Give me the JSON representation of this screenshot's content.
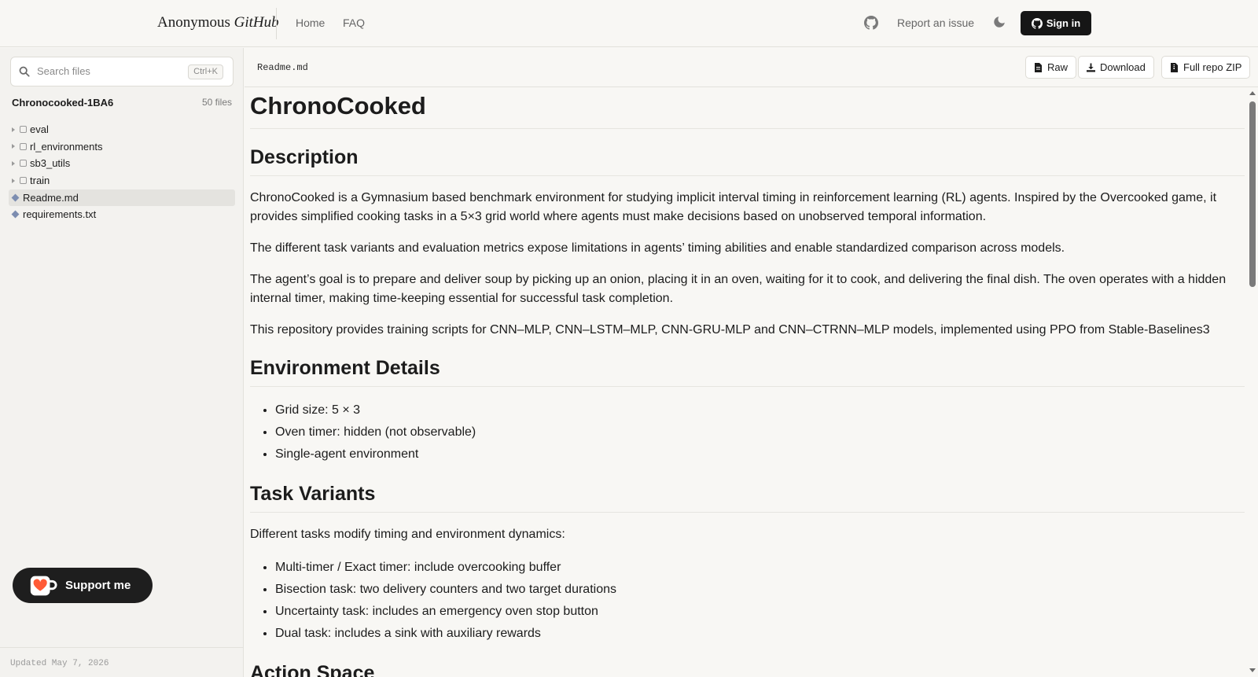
{
  "header": {
    "brand_main": "Anonymous ",
    "brand_italic": "GitHub",
    "nav": [
      "Home",
      "FAQ"
    ],
    "github_icon": "github-icon",
    "report": "Report an issue",
    "theme_icon": "moon-icon",
    "signin": "Sign in"
  },
  "sidebar": {
    "search_placeholder": "Search files",
    "search_shortcut": "Ctrl+K",
    "repo_name": "Chronocooked-1BA6",
    "file_count": "50 files",
    "tree": [
      {
        "label": "eval",
        "type": "folder"
      },
      {
        "label": "rl_environments",
        "type": "folder"
      },
      {
        "label": "sb3_utils",
        "type": "folder"
      },
      {
        "label": "train",
        "type": "folder"
      },
      {
        "label": "Readme.md",
        "type": "file",
        "active": true
      },
      {
        "label": "requirements.txt",
        "type": "file"
      }
    ],
    "updated": "Updated May 7, 2026",
    "support": "Support me"
  },
  "file_header": {
    "path": "Readme.md",
    "raw": "Raw",
    "download": "Download",
    "zip": "Full repo ZIP"
  },
  "readme": {
    "title": "ChronoCooked",
    "description_heading": "Description",
    "p1": "ChronoCooked is a Gymnasium based benchmark environment for studying implicit interval timing in reinforcement learning (RL) agents. Inspired by the Overcooked game, it provides simplified cooking tasks in a 5×3 grid world where agents must make decisions based on unobserved temporal information.",
    "p2": "The different task variants and evaluation metrics expose limitations in agents’ timing abilities and enable standardized comparison across models.",
    "p3": "The agent’s goal is to prepare and deliver soup by picking up an onion, placing it in an oven, waiting for it to cook, and delivering the final dish. The oven operates with a hidden internal timer, making time-keeping essential for successful task completion.",
    "p4": "This repository provides training scripts for CNN–MLP, CNN–LSTM–MLP, CNN-GRU-MLP and CNN–CTRNN–MLP models, implemented using PPO from Stable-Baselines3",
    "env_heading": "Environment Details",
    "env_items": [
      "Grid size: 5 × 3",
      "Oven timer: hidden (not observable)",
      "Single-agent environment"
    ],
    "task_heading": "Task Variants",
    "task_intro": "Different tasks modify timing and environment dynamics:",
    "task_items": [
      "Multi-timer / Exact timer: include overcooking buffer",
      "Bisection task: two delivery counters and two target durations",
      "Uncertainty task: includes an emergency oven stop button",
      "Dual task: includes a sink with auxiliary rewards"
    ],
    "action_heading": "Action Space"
  }
}
